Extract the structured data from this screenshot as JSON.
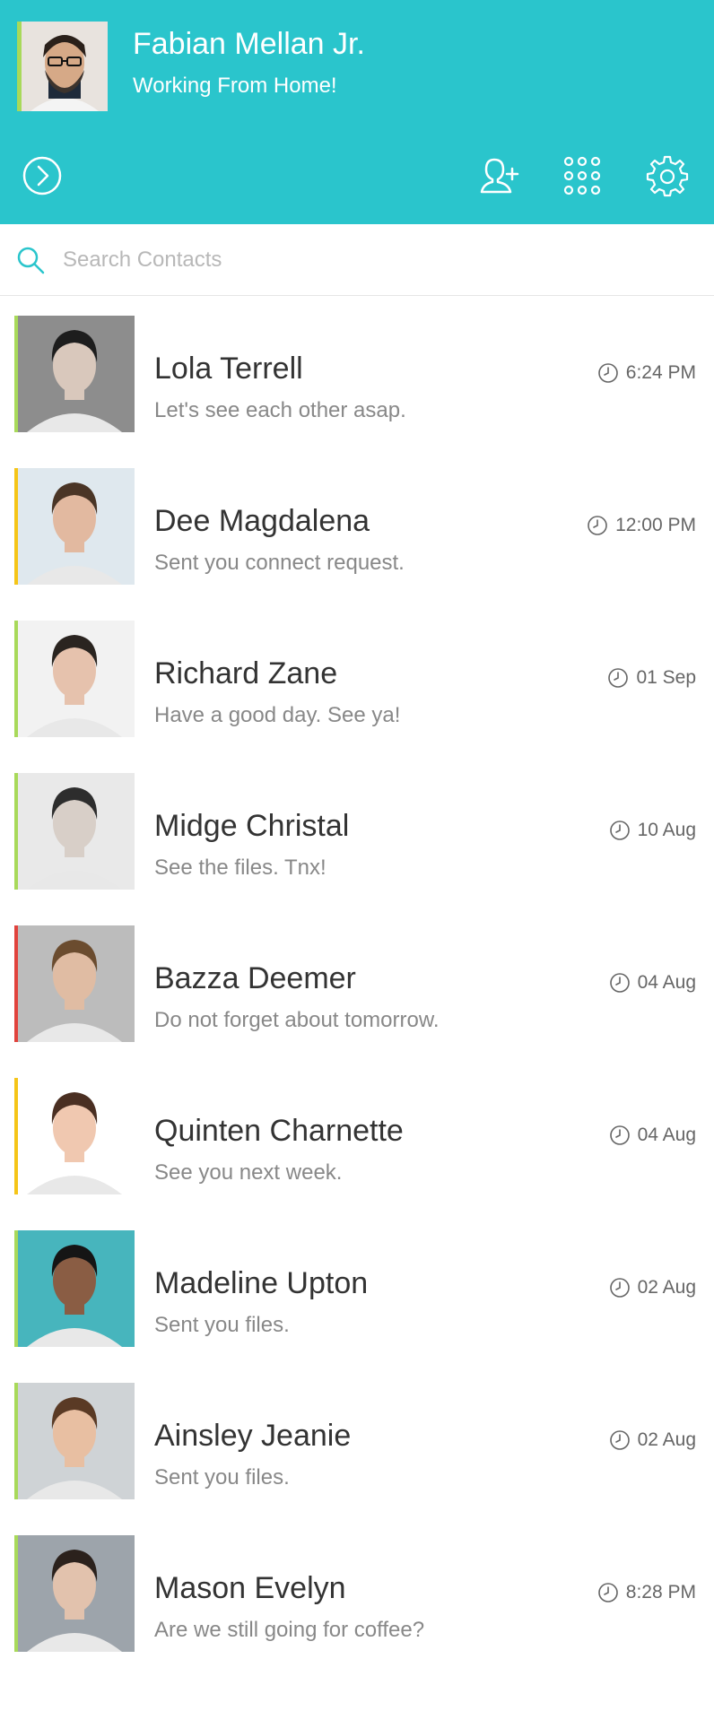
{
  "profile": {
    "name": "Fabian Mellan Jr.",
    "status": "Working From Home!"
  },
  "header_icons": [
    "arrow-right-circle-icon",
    "add-user-icon",
    "apps-grid-icon",
    "gear-icon"
  ],
  "colors": {
    "header_bg": "#2ac5cc",
    "accent_green": "#a8d95a",
    "accent_yellow": "#f5c518",
    "accent_red": "#e0423c"
  },
  "search": {
    "placeholder": "Search Contacts"
  },
  "contacts": [
    {
      "name": "Lola Terrell",
      "message": "Let's see each other asap.",
      "time": "6:24 PM",
      "status_color": "#a8d95a",
      "avatar_bg": "#8d8d8d",
      "skin": "#d9c8bc",
      "hair": "#1d1d1d"
    },
    {
      "name": "Dee Magdalena",
      "message": "Sent you connect request.",
      "time": "12:00 PM",
      "status_color": "#f5c518",
      "avatar_bg": "#dfe8ee",
      "skin": "#e2b9a0",
      "hair": "#4a3526"
    },
    {
      "name": "Richard Zane",
      "message": "Have a good day. See ya!",
      "time": "01 Sep",
      "status_color": "#a8d95a",
      "avatar_bg": "#f2f2f2",
      "skin": "#e6c2ad",
      "hair": "#2a2420"
    },
    {
      "name": "Midge Christal",
      "message": "See the files. Tnx!",
      "time": "10 Aug",
      "status_color": "#a8d95a",
      "avatar_bg": "#e9e9e9",
      "skin": "#d8cfc8",
      "hair": "#2d2d2d"
    },
    {
      "name": "Bazza Deemer",
      "message": "Do not forget about tomorrow.",
      "time": "04 Aug",
      "status_color": "#e0423c",
      "avatar_bg": "#bcbcbc",
      "skin": "#e0bca3",
      "hair": "#6b4c2f"
    },
    {
      "name": "Quinten Charnette",
      "message": "See you next week.",
      "time": "04 Aug",
      "status_color": "#f5c518",
      "avatar_bg": "#ffffff",
      "skin": "#f0c8b0",
      "hair": "#4a2f22"
    },
    {
      "name": "Madeline Upton",
      "message": "Sent you files.",
      "time": "02 Aug",
      "status_color": "#a8d95a",
      "avatar_bg": "#47b5bd",
      "skin": "#8a5d44",
      "hair": "#151515"
    },
    {
      "name": "Ainsley Jeanie",
      "message": "Sent you files.",
      "time": "02 Aug",
      "status_color": "#a8d95a",
      "avatar_bg": "#cfd3d6",
      "skin": "#e8bfa2",
      "hair": "#5a3a25"
    },
    {
      "name": "Mason Evelyn",
      "message": "Are we still going for coffee?",
      "time": "8:28 PM",
      "status_color": "#a8d95a",
      "avatar_bg": "#9da4ab",
      "skin": "#e2c2ad",
      "hair": "#2b211c"
    }
  ]
}
